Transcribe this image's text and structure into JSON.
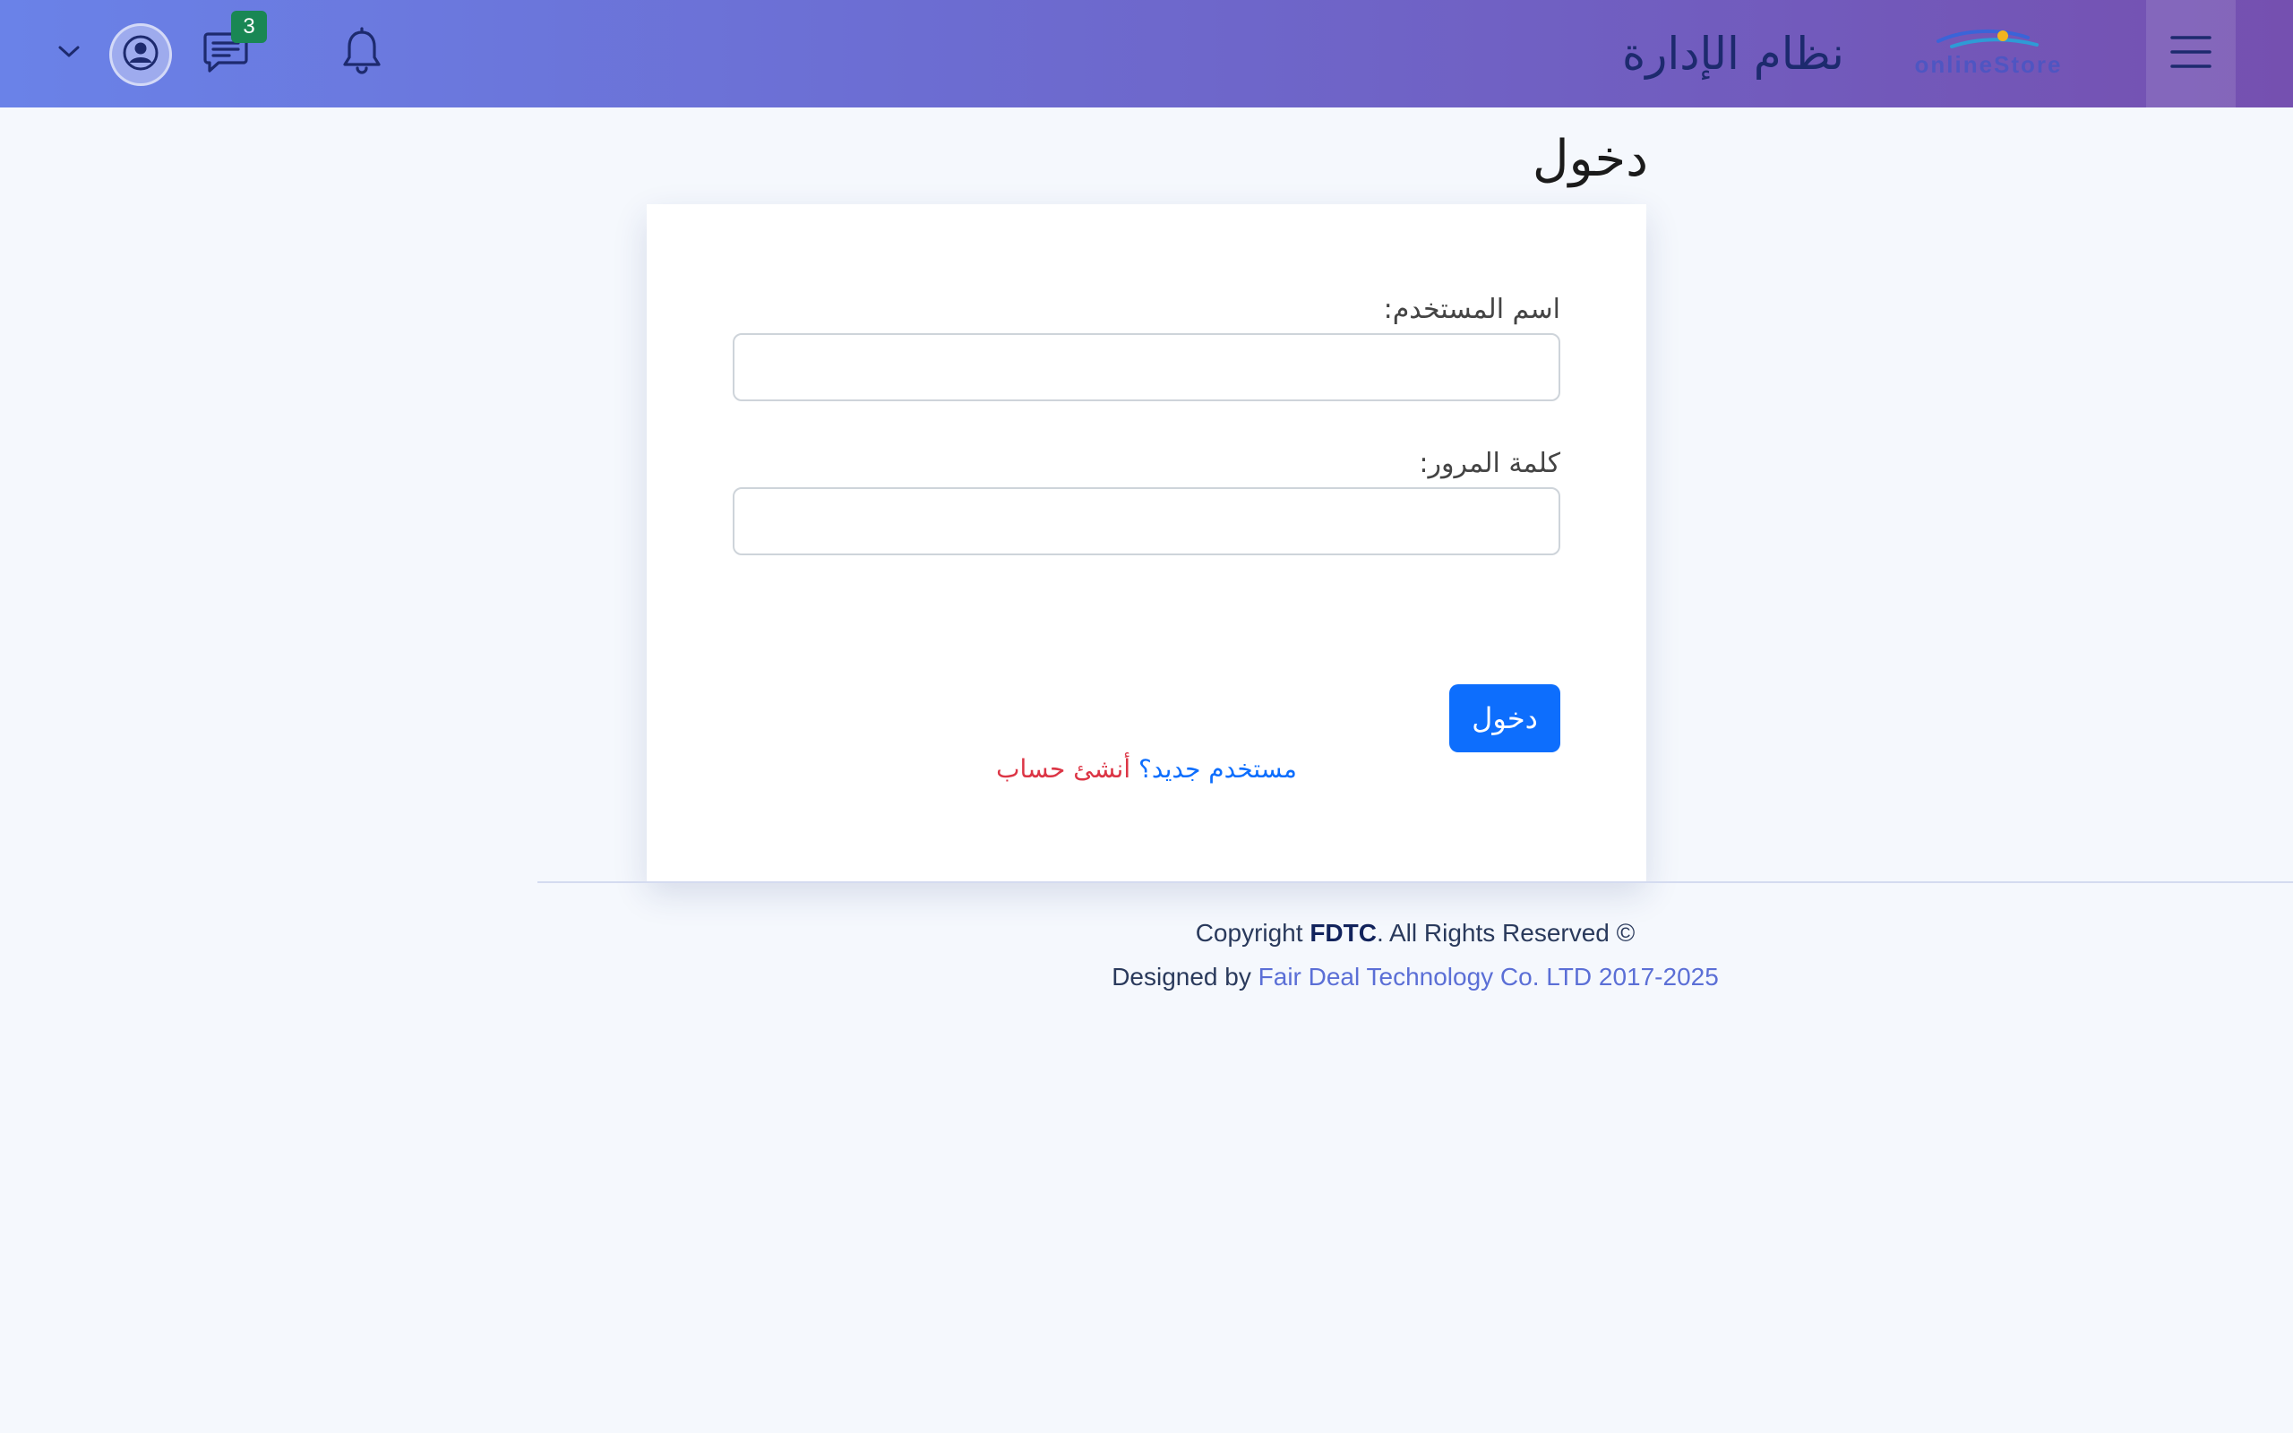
{
  "header": {
    "title": "نظام الإدارة",
    "logo_text": "onlineStore",
    "messages_count": "3",
    "icons": {
      "menu": "hamburger-menu-icon",
      "notifications": "bell-icon",
      "messages": "chat-message-icon",
      "user": "user-circle-icon",
      "dropdown": "chevron-down-icon"
    },
    "colors": {
      "gradient_start": "#6a82e8",
      "gradient_end": "#7550b0",
      "badge": "#198754",
      "icon": "#1d2a6e"
    }
  },
  "page": {
    "title": "دخول"
  },
  "login_form": {
    "username_label": "اسم المستخدم:",
    "username_value": "",
    "password_label": "كلمة المرور:",
    "password_value": "",
    "submit_label": "دخول",
    "new_user_question": "مستخدم جديد؟",
    "create_account_link": "أنشئ حساب",
    "colors": {
      "button": "#0d6efd",
      "question": "#0d6efd",
      "link": "#dc3545"
    }
  },
  "footer": {
    "copyright_prefix": "Copyright ",
    "copyright_brand": "FDTC",
    "copyright_suffix": ". All Rights Reserved ©",
    "designed_prefix": "Designed by ",
    "designed_company": "Fair Deal Technology Co. LTD 2017-2025"
  }
}
